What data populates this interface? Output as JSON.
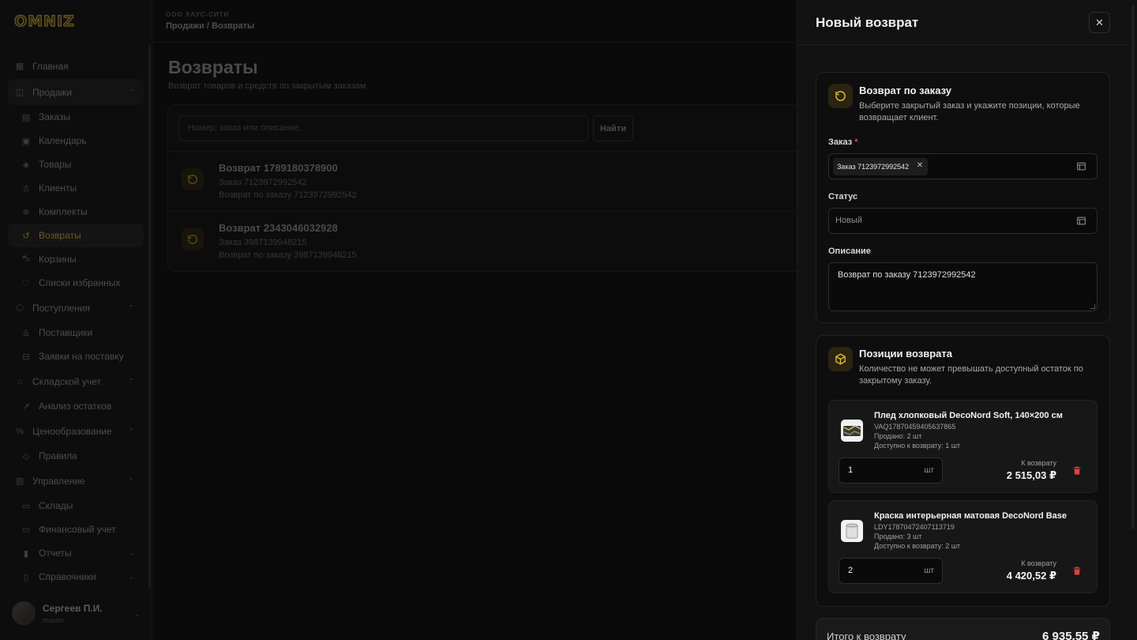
{
  "sidebar": {
    "logo": "OMNIZ",
    "items": [
      {
        "label": "Главная",
        "icon": "grid-icon",
        "level": "top"
      },
      {
        "label": "Продажи",
        "icon": "shopping-bag-icon",
        "level": "top",
        "expanded": true
      },
      {
        "label": "Заказы",
        "icon": "receipt-icon",
        "level": "sub"
      },
      {
        "label": "Календарь",
        "icon": "calendar-icon",
        "level": "sub"
      },
      {
        "label": "Товары",
        "icon": "box-icon",
        "level": "sub"
      },
      {
        "label": "Клиенты",
        "icon": "user-icon",
        "level": "sub"
      },
      {
        "label": "Комплекты",
        "icon": "layers-icon",
        "level": "sub"
      },
      {
        "label": "Возвраты",
        "icon": "rotate-ccw-icon",
        "level": "sub",
        "active": true
      },
      {
        "label": "Корзины",
        "icon": "cart-icon",
        "level": "sub"
      },
      {
        "label": "Списки избранных",
        "icon": "heart-icon",
        "level": "sub"
      },
      {
        "label": "Поступления",
        "icon": "package-icon",
        "level": "top",
        "expanded": true
      },
      {
        "label": "Поставщики",
        "icon": "users-icon",
        "level": "sub"
      },
      {
        "label": "Заявки на поставку",
        "icon": "inbox-icon",
        "level": "sub"
      },
      {
        "label": "Складской учет",
        "icon": "warehouse-icon",
        "level": "top",
        "expanded": true
      },
      {
        "label": "Анализ остатков",
        "icon": "trend-icon",
        "level": "sub"
      },
      {
        "label": "Ценообразование",
        "icon": "percent-icon",
        "level": "top",
        "expanded": true
      },
      {
        "label": "Правила",
        "icon": "tag-icon",
        "level": "sub"
      },
      {
        "label": "Управление",
        "icon": "settings-panel-icon",
        "level": "top",
        "expanded": true
      },
      {
        "label": "Склады",
        "icon": "folder-icon",
        "level": "sub"
      },
      {
        "label": "Финансовый учет",
        "icon": "wallet-icon",
        "level": "sub"
      },
      {
        "label": "Отчеты",
        "icon": "bar-chart-icon",
        "level": "sub",
        "collapsible": true
      },
      {
        "label": "Справочники",
        "icon": "book-icon",
        "level": "sub",
        "collapsible": true
      }
    ],
    "user": {
      "name": "Сергеев П.И.",
      "role": "master"
    }
  },
  "topbar": {
    "org": "ООО ХАУС-СИТИ",
    "breadcrumb": "Продажи / Возвраты"
  },
  "page": {
    "title": "Возвраты",
    "subtitle": "Возврат товаров и средств по закрытым заказам",
    "search_placeholder": "Номер, заказ или описание...",
    "find_label": "Найти",
    "rows": [
      {
        "title": "Возврат 1789180378900",
        "order": "Заказ 7123972992542",
        "desc": "Возврат по заказу 7123972992542"
      },
      {
        "title": "Возврат 2343046032928",
        "order": "Заказ 3987139948215",
        "desc": "Возврат по заказу 3987139948215"
      }
    ]
  },
  "drawer": {
    "title": "Новый возврат",
    "order_panel": {
      "title": "Возврат по заказу",
      "desc": "Выберите закрытый заказ и укажите позиции, которые возвращает клиент.",
      "order_label": "Заказ",
      "required_mark": "*",
      "order_chip": "Заказ 7123972992542",
      "status_label": "Статус",
      "status_value": "Новый",
      "desc_label": "Описание",
      "desc_value": "Возврат по заказу 7123972992542"
    },
    "items_panel": {
      "title": "Позиции возврата",
      "desc": "Количество не может превышать доступный остаток по закрытому заказу.",
      "return_label": "К возврату",
      "unit": "шт",
      "items": [
        {
          "name": "Плед хлопковый DecoNord Soft, 140×200 см",
          "sku": "VAQ17870459405637865",
          "sold": "Продано: 2 шт",
          "available": "Доступно к возврату: 1 шт",
          "qty": "1",
          "amount": "2 515,03 ₽"
        },
        {
          "name": "Краска интерьерная матовая DecoNord Base",
          "sku": "LDY17870472407113719",
          "sold": "Продано: 3 шт",
          "available": "Доступно к возврату: 2 шт",
          "qty": "2",
          "amount": "4 420,52 ₽"
        }
      ]
    },
    "total": {
      "label": "Итого к возврату",
      "value": "6 935,55 ₽"
    }
  },
  "colors": {
    "accent": "#e3b92c",
    "danger": "#d9433a",
    "background": "#0a0a0a",
    "drawer": "#121212"
  }
}
